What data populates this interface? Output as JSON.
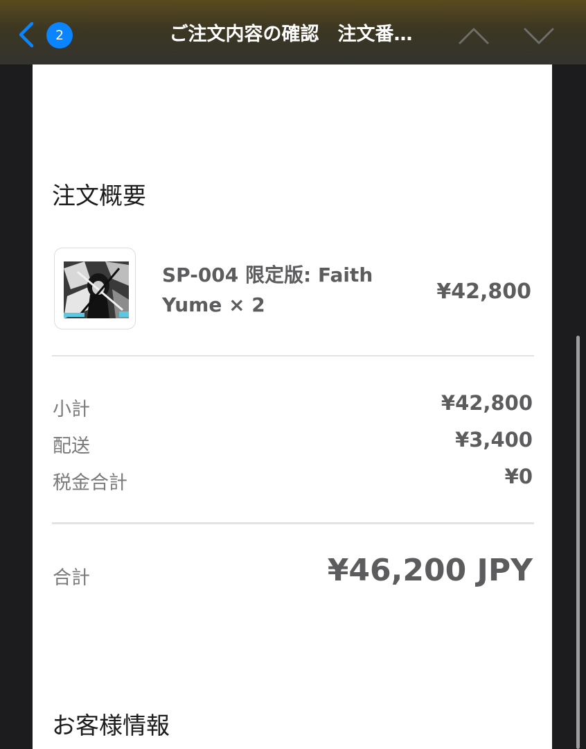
{
  "nav": {
    "back_badge_count": "2",
    "title": "ご注文内容の確認　注文番…"
  },
  "order_summary": {
    "heading": "注文概要",
    "item": {
      "name": "SP-004 限定版: Faith Yume × 2",
      "price": "¥42,800"
    },
    "rows": [
      {
        "label": "小計",
        "value": "¥42,800"
      },
      {
        "label": "配送",
        "value": "¥3,400"
      },
      {
        "label": "税金合計",
        "value": "¥0"
      }
    ],
    "total": {
      "label": "合計",
      "value": "¥46,200 JPY"
    }
  },
  "customer_info": {
    "heading": "お客様情報"
  },
  "colors": {
    "accent": "#0a84ff",
    "page_background": "#ffffff",
    "frame_background": "#1c1c1e",
    "text_secondary": "#5c5c5e"
  }
}
